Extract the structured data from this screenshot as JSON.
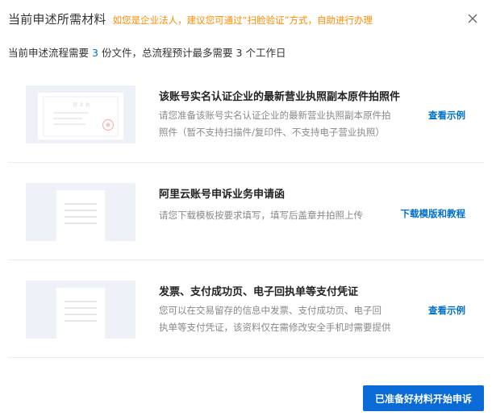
{
  "header": {
    "title": "当前申述所需材料",
    "tip": "如您是企业法人，建议您可通过“扫脸验证”方式，自助进行办理"
  },
  "summary": {
    "part1": "当前申述流程需要",
    "file_count": "3",
    "part2": "份文件，总流程预计最多需要",
    "day_count": "3",
    "part3": "个工作日"
  },
  "documents": [
    {
      "title": "该账号实名认证企业的最新营业执照副本原件拍照件",
      "desc_line1": "请您准备该账号实名认证企业的最新营业执照副本原件拍",
      "desc_line2": "照件（暂不支持扫描件/复印件、不支持电子营业执照）",
      "link": "查看示例",
      "thumb_icon": "business-license-icon"
    },
    {
      "title": "阿里云账号申诉业务申请函",
      "desc_line1": "请您下载模板按要求填写，填写后盖章并拍照上传",
      "link": "下载模版和教程",
      "thumb_icon": "form-document-icon"
    },
    {
      "title": "发票、支付成功页、电子回执单等支付凭证",
      "desc_line1": "您可以在交易留存的信息中发票、支付成功页、电子回",
      "desc_line2": "执单等支付凭证，该资料仅在需修改安全手机时需要提供",
      "link": "查看示例",
      "thumb_icon": "payment-receipt-icon"
    }
  ],
  "footer": {
    "primary_button": "已准备好材料开始申诉"
  },
  "colors": {
    "accent": "#0070cc",
    "tip": "#ff8a00",
    "button": "#0a6bd6",
    "thumb_bg": "#eef2f8"
  }
}
